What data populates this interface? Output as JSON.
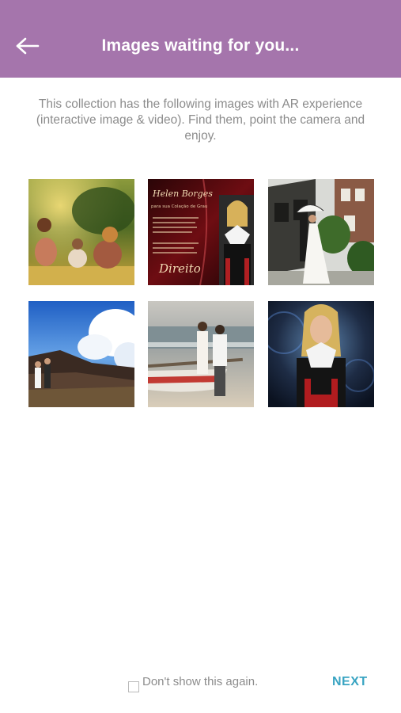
{
  "header": {
    "title": "Images waiting for you...",
    "background_color": "#a575ac",
    "back_icon": "arrow-left-icon"
  },
  "intro": {
    "text": "This collection has the following images with AR experience (interactive image & video). Find them, point the camera and enjoy."
  },
  "gallery": {
    "images": [
      {
        "name": "family-outdoor-photo"
      },
      {
        "name": "graduation-invitation-photo"
      },
      {
        "name": "wedding-couple-umbrella-photo"
      },
      {
        "name": "couple-beach-rocks-photo"
      },
      {
        "name": "couple-boat-beach-photo"
      },
      {
        "name": "graduation-portrait-photo"
      }
    ]
  },
  "invitation_card": {
    "name": "Helen Borges",
    "subtitle": "para sua Colação de Grau",
    "course": "Direito"
  },
  "footer": {
    "checkbox_label": "Don't show this again.",
    "checkbox_checked": false,
    "next_label": "NEXT",
    "next_color": "#39a4c2"
  }
}
